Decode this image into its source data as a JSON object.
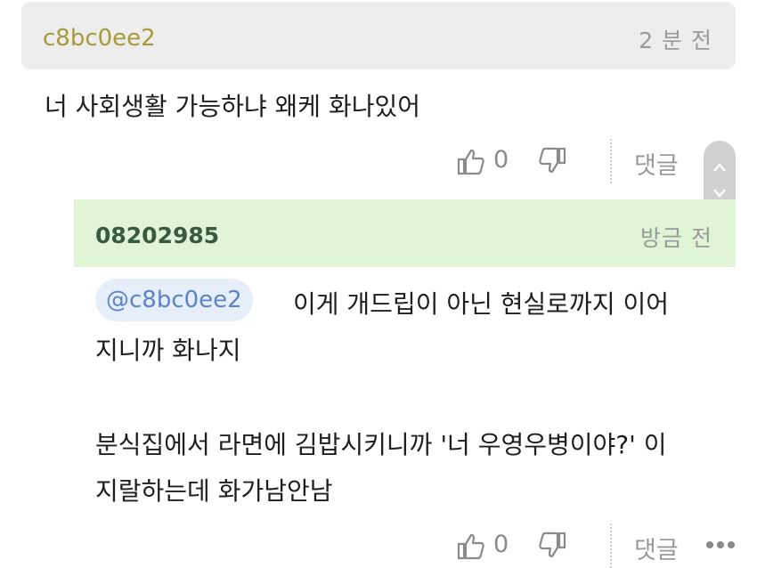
{
  "comment": {
    "author": "c8bc0ee2",
    "time": "2 분 전",
    "body": "너 사회생활 가능하냐 왜케 화나있어",
    "likes": "0",
    "reply_label": "댓글"
  },
  "reply": {
    "author": "08202985",
    "time": "방금 전",
    "mention": "@c8bc0ee2",
    "lines": [
      "이게 개드립이 아닌 현실로까지 이어",
      "지니까 화나지",
      "분식집에서 라면에 김밥시키니까 '너 우영우병이야?' 이",
      "지랄하는데 화가남안남"
    ],
    "likes": "0",
    "reply_label": "댓글"
  },
  "icons": {
    "like": "thumbs-up-icon",
    "dislike": "thumbs-down-icon",
    "more": "more-dots-icon",
    "scroll_up": "chevron-up-icon",
    "scroll_down": "chevron-down-icon"
  },
  "colors": {
    "author_main": "#a79a3c",
    "reply_header_bg": "#dff5d6",
    "mention_text": "#5c82c8"
  }
}
